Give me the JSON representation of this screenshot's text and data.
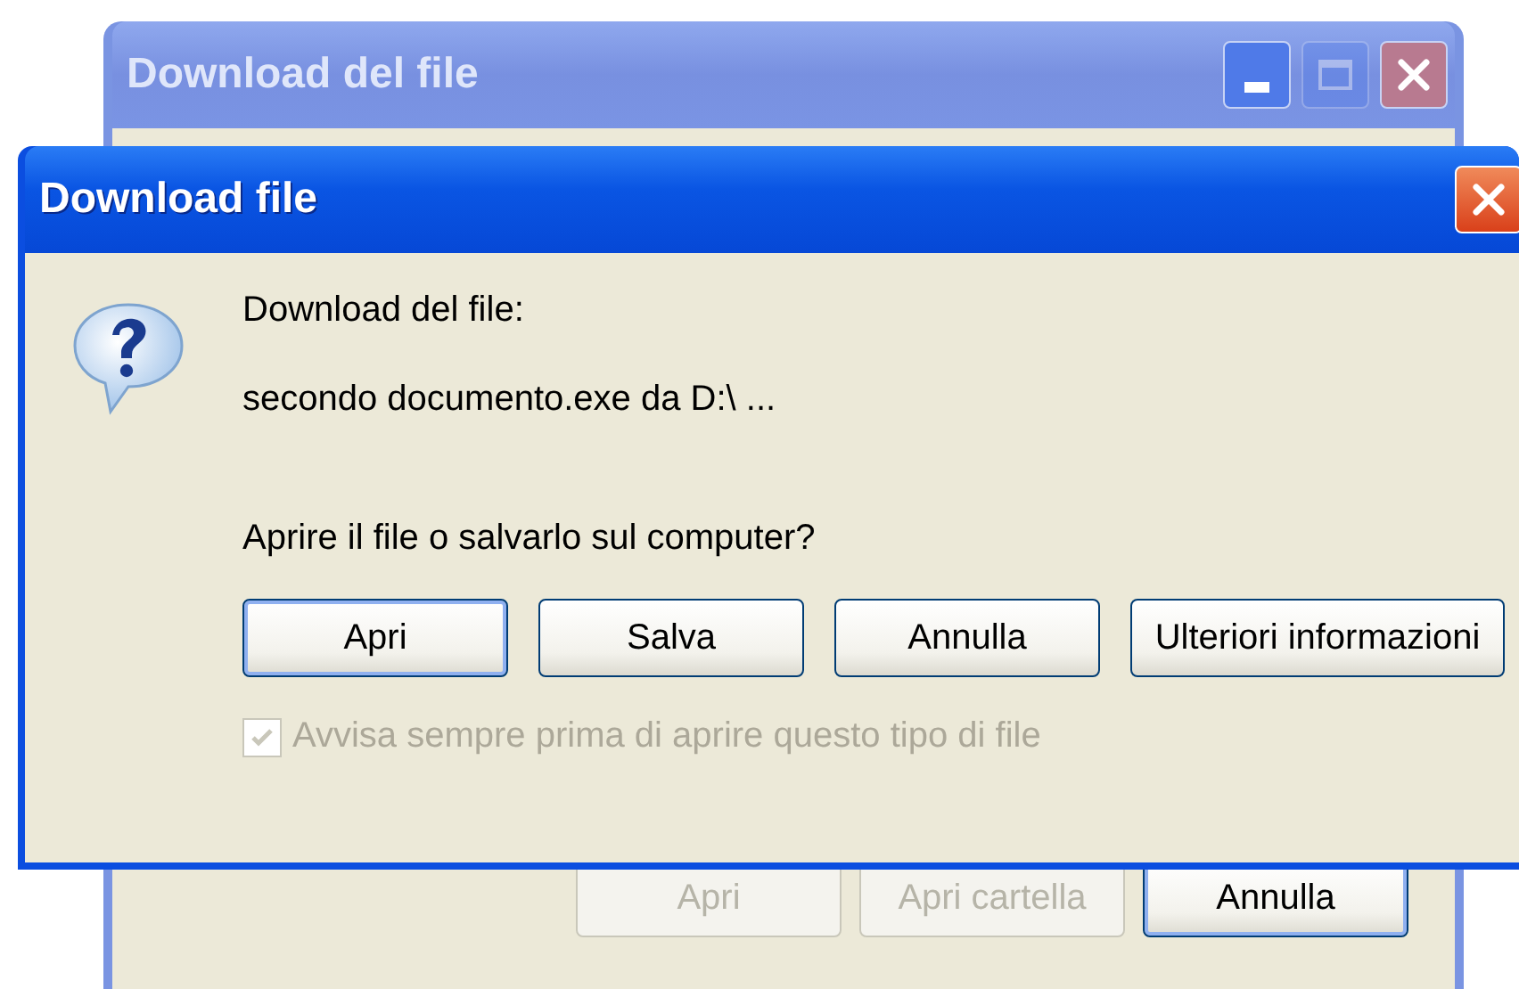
{
  "back_window": {
    "title": "Download del file",
    "title_buttons": [
      {
        "kind": "minimize",
        "disabled": false
      },
      {
        "kind": "maximize",
        "disabled": true
      },
      {
        "kind": "close",
        "disabled": false
      }
    ],
    "buttons": [
      {
        "label": "Apri",
        "disabled": true,
        "default": false
      },
      {
        "label": "Apri cartella",
        "disabled": true,
        "default": false
      },
      {
        "label": "Annulla",
        "disabled": false,
        "default": true
      }
    ]
  },
  "dialog": {
    "title": "Download file",
    "title_buttons": [
      {
        "kind": "close",
        "disabled": false
      }
    ],
    "heading": "Download del file:",
    "file": "secondo documento.exe da D:\\ ...",
    "question": "Aprire il file o salvarlo sul computer?",
    "buttons": [
      {
        "label": "Apri",
        "disabled": false,
        "default": true
      },
      {
        "label": "Salva",
        "disabled": false,
        "default": false
      },
      {
        "label": "Annulla",
        "disabled": false,
        "default": false
      },
      {
        "label": "Ulteriori informazioni",
        "disabled": false,
        "default": false
      }
    ],
    "checkbox": {
      "label": "Avvisa sempre prima di aprire questo tipo di file",
      "checked": true,
      "disabled": true
    }
  }
}
